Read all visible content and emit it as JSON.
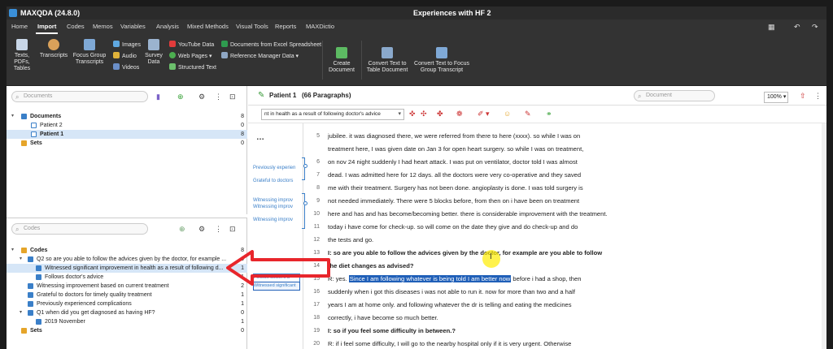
{
  "window": {
    "app_title": "MAXQDA (24.8.0)",
    "doc_title": "Experiences with HF 2"
  },
  "menu": {
    "tabs": [
      "Home",
      "Import",
      "Codes",
      "Memos",
      "Variables",
      "Analysis",
      "Mixed Methods",
      "Visual Tools",
      "Reports",
      "MAXDictio"
    ],
    "active": "Import"
  },
  "ribbon": {
    "texts": "Texts, PDFs,\nTables",
    "transcripts": "Transcripts",
    "focus_group": "Focus Group\nTranscripts",
    "images": "Images",
    "audio": "Audio",
    "videos": "Videos",
    "survey": "Survey\nData",
    "youtube": "YouTube Data",
    "web_pages": "Web Pages",
    "structured": "Structured Text",
    "excel": "Documents from Excel Spreadsheet",
    "reference": "Reference Manager Data",
    "create": "Create\nDocument",
    "convert_table": "Convert Text to\nTable Document",
    "convert_focus": "Convert Text to Focus\nGroup Transcript"
  },
  "documents_panel": {
    "search_placeholder": "Documents",
    "rows": [
      {
        "label": "Documents",
        "count": "8"
      },
      {
        "label": "Patient 2",
        "count": "0"
      },
      {
        "label": "Patient 1",
        "count": "8"
      },
      {
        "label": "Sets",
        "count": "0"
      }
    ]
  },
  "codes_panel": {
    "search_placeholder": "Codes",
    "rows": [
      {
        "label": "Codes",
        "count": "8"
      },
      {
        "label": "Q2 so are you able to follow the advices given by the doctor, for example ...",
        "count": "0"
      },
      {
        "label": "Witnessed significant improvement in health as a result of following d...",
        "count": "1"
      },
      {
        "label": "Follows doctor's advice",
        "count": "1"
      },
      {
        "label": "Witnessing improvement based on current treatment",
        "count": "2"
      },
      {
        "label": "Grateful to doctors for timely quality treatment",
        "count": "1"
      },
      {
        "label": "Previously experienced complications",
        "count": "1"
      },
      {
        "label": "Q1 when did you get diagnosed as having HF?",
        "count": "0"
      },
      {
        "label": "2019 November",
        "count": "1"
      },
      {
        "label": "Sets",
        "count": "0"
      }
    ]
  },
  "document": {
    "name": "Patient 1",
    "paragraphs_info": "(66 Paragraphs)",
    "search_placeholder": "Document",
    "zoom": "100%",
    "code_filter": "nt in health as a result of following doctor's advice",
    "coding_labels": {
      "previously": "Previously experien",
      "grateful": "Grateful to doctors",
      "witness1": "Witnessing improv",
      "witness2": "Witnessing improv",
      "witness3": "Witnessing improv",
      "follows": "Follows doctor's a",
      "witnessed_sig": "Witnessed significant"
    },
    "lines": [
      {
        "n": "5",
        "text": "jubilee. it was diagnosed there, we were referred from there to here (xxxx). so while I was on",
        "bold": false
      },
      {
        "n": "",
        "text": "treatment here, I was given date on Jan 3 for open heart surgery. so while I was on treatment,",
        "bold": false
      },
      {
        "n": "6",
        "text": "on nov 24 night suddenly I had heart attack. I was put on ventilator, doctor told I was almost",
        "bold": false
      },
      {
        "n": "7",
        "text": "dead. I was admitted here for 12 days. all the doctors were very co-operative and they saved",
        "bold": false
      },
      {
        "n": "8",
        "text": "me with their treatment. Surgery has not been done. angioplasty is done. I was told surgery is",
        "bold": false
      },
      {
        "n": "9",
        "text": "not needed immediately. There were 5 blocks before, from then on i have been on treatment",
        "bold": false
      },
      {
        "n": "10",
        "text": "here and has and has become/becoming better. there is considerable improvement with the treatment.",
        "bold": false
      },
      {
        "n": "11",
        "text": "today i have come for check-up. so will come on the date they give and do check-up and do",
        "bold": false
      },
      {
        "n": "12",
        "text": "the tests and go.",
        "bold": false
      },
      {
        "n": "13",
        "text": "I: so are you able to follow the advices given by the doctor, for example are you able to follow",
        "bold": true
      },
      {
        "n": "14",
        "text": "the diet changes as advised?",
        "bold": true
      },
      {
        "n": "15",
        "text_pre": "R: yes. ",
        "text_hl": "Since I am following whatever is being told I am better now",
        "text_post": " before i had a shop, then",
        "bold": false
      },
      {
        "n": "16",
        "text": "suddenly when i got this diseases i was not able to run it. now for more than two and a half",
        "bold": false
      },
      {
        "n": "17",
        "text": "years I am at home only. and following whatever the dr is telling and eating the medicines",
        "bold": false
      },
      {
        "n": "18",
        "text": "correctly, i have become so much better.",
        "bold": false
      },
      {
        "n": "19",
        "text": "I: so if you feel some difficulty in between.?",
        "bold": true
      },
      {
        "n": "20",
        "text": "R: if i feel some difficulty, I will go to the nearby hospital only if it is very urgent. Otherwise",
        "bold": false
      }
    ]
  },
  "colors": {
    "accent": "#3a7fc8",
    "highlight": "#1f5fb8",
    "arrow": "#e8262c",
    "selection": "#d6e6f7"
  }
}
